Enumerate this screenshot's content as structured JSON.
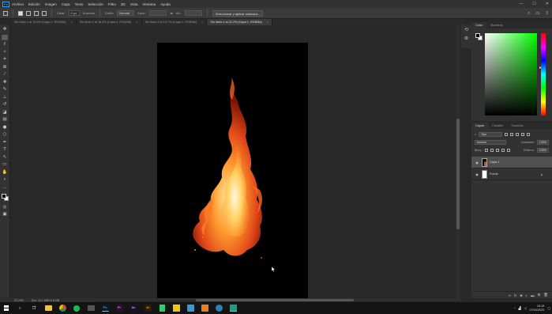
{
  "menubar": {
    "logo": "Ps",
    "items": [
      "Archivo",
      "Edición",
      "Imagen",
      "Capa",
      "Texto",
      "Selección",
      "Filtro",
      "3D",
      "Vista",
      "Ventana",
      "Ayuda"
    ],
    "window_controls": [
      "—",
      "☐",
      "✕"
    ]
  },
  "options": {
    "feather_label": "Calar:",
    "feather_value": "0 px",
    "antialias_label": "Suavizar",
    "style_label": "Estilo:",
    "style_value": "Normal",
    "width_label": "Anch.:",
    "height_label": "Alt.:",
    "select_mask_button": "Seleccionar y aplicar máscara..."
  },
  "tabs": [
    {
      "label": "Sin título-1 al 16,5% (Capa 1, RGB/8#)"
    },
    {
      "label": "Sin título-2 al 16,9% (Capa 2, RGB/8#)"
    },
    {
      "label": "Sin título-3 al 16,7% (Capa 1, RGB/8#)"
    },
    {
      "label": "Sin título-4 al 22,2% (Capa 1, RGB/8#)",
      "active": true
    }
  ],
  "status": {
    "zoom": "22,22%",
    "doc": "Doc: 12,1 MB/10,8 MB"
  },
  "color_panel": {
    "tabs": [
      "Color",
      "Muestras"
    ],
    "hue_color": "#00ff00"
  },
  "layers_panel": {
    "tabs": [
      "Capas",
      "Canales",
      "Trazados"
    ],
    "filter_kind": "Tipo",
    "blend_mode": "Normal",
    "opacity_label": "Opacidad:",
    "opacity_value": "100%",
    "lock_label": "Bloq.:",
    "fill_label": "Relleno:",
    "fill_value": "100%",
    "layers": [
      {
        "name": "Capa 1",
        "selected": true
      },
      {
        "name": "Fondo",
        "locked": true
      }
    ]
  },
  "taskbar": {
    "apps": [
      {
        "name": "Ps",
        "color": "#31a8ff",
        "bg": "#0b1a2d"
      },
      {
        "name": "Pr",
        "color": "#ea77ff",
        "bg": "#2a0f33"
      },
      {
        "name": "Ae",
        "color": "#d291ff",
        "bg": "#1c0f33"
      },
      {
        "name": "Ai",
        "color": "#ff9a00",
        "bg": "#2f1900"
      }
    ],
    "time": "15:18",
    "date": "07/04/2020"
  }
}
